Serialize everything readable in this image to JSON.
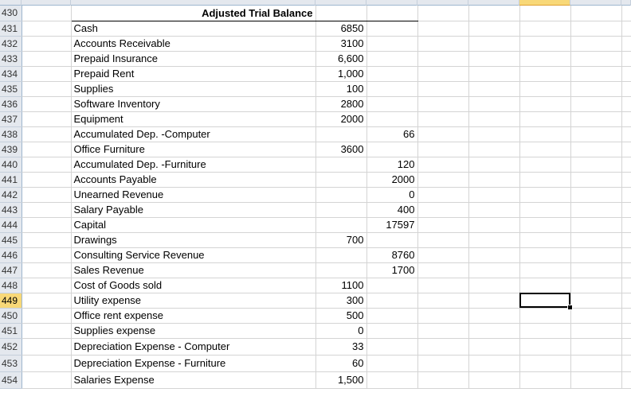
{
  "sheet": {
    "title": "Adjusted Trial Balance",
    "selected_cell": {
      "row": "449",
      "column": "G"
    },
    "rows": [
      {
        "row": "430",
        "label": "",
        "debit": "",
        "credit": ""
      },
      {
        "row": "431",
        "label": "Cash",
        "debit": "6850",
        "credit": ""
      },
      {
        "row": "432",
        "label": "Accounts Receivable",
        "debit": "3100",
        "credit": ""
      },
      {
        "row": "433",
        "label": "Prepaid Insurance",
        "debit": "6,600",
        "credit": ""
      },
      {
        "row": "434",
        "label": "Prepaid Rent",
        "debit": "1,000",
        "credit": ""
      },
      {
        "row": "435",
        "label": "Supplies",
        "debit": "100",
        "credit": ""
      },
      {
        "row": "436",
        "label": "Software Inventory",
        "debit": "2800",
        "credit": ""
      },
      {
        "row": "437",
        "label": "Equipment",
        "debit": "2000",
        "credit": ""
      },
      {
        "row": "438",
        "label": "Accumulated Dep. -Computer",
        "debit": "",
        "credit": "66"
      },
      {
        "row": "439",
        "label": "Office Furniture",
        "debit": "3600",
        "credit": ""
      },
      {
        "row": "440",
        "label": "Accumulated Dep. -Furniture",
        "debit": "",
        "credit": "120"
      },
      {
        "row": "441",
        "label": "Accounts Payable",
        "debit": "",
        "credit": "2000"
      },
      {
        "row": "442",
        "label": "Unearned Revenue",
        "debit": "",
        "credit": "0"
      },
      {
        "row": "443",
        "label": "Salary Payable",
        "debit": "",
        "credit": "400"
      },
      {
        "row": "444",
        "label": "Capital",
        "debit": "",
        "credit": "17597"
      },
      {
        "row": "445",
        "label": "Drawings",
        "debit": "700",
        "credit": ""
      },
      {
        "row": "446",
        "label": "Consulting Service Revenue",
        "debit": "",
        "credit": "8760"
      },
      {
        "row": "447",
        "label": "Sales Revenue",
        "debit": "",
        "credit": "1700"
      },
      {
        "row": "448",
        "label": "Cost of Goods sold",
        "debit": "1100",
        "credit": ""
      },
      {
        "row": "449",
        "label": "Utility expense",
        "debit": "300",
        "credit": ""
      },
      {
        "row": "450",
        "label": "Office rent expense",
        "debit": "500",
        "credit": ""
      },
      {
        "row": "451",
        "label": "Supplies expense",
        "debit": "0",
        "credit": ""
      },
      {
        "row": "452",
        "label": "Depreciation Expense  - Computer",
        "debit": "33",
        "credit": ""
      },
      {
        "row": "453",
        "label": "Depreciation Expense  -  Furniture",
        "debit": "60",
        "credit": ""
      },
      {
        "row": "454",
        "label": "Salaries  Expense",
        "debit": "1,500",
        "credit": ""
      }
    ]
  }
}
